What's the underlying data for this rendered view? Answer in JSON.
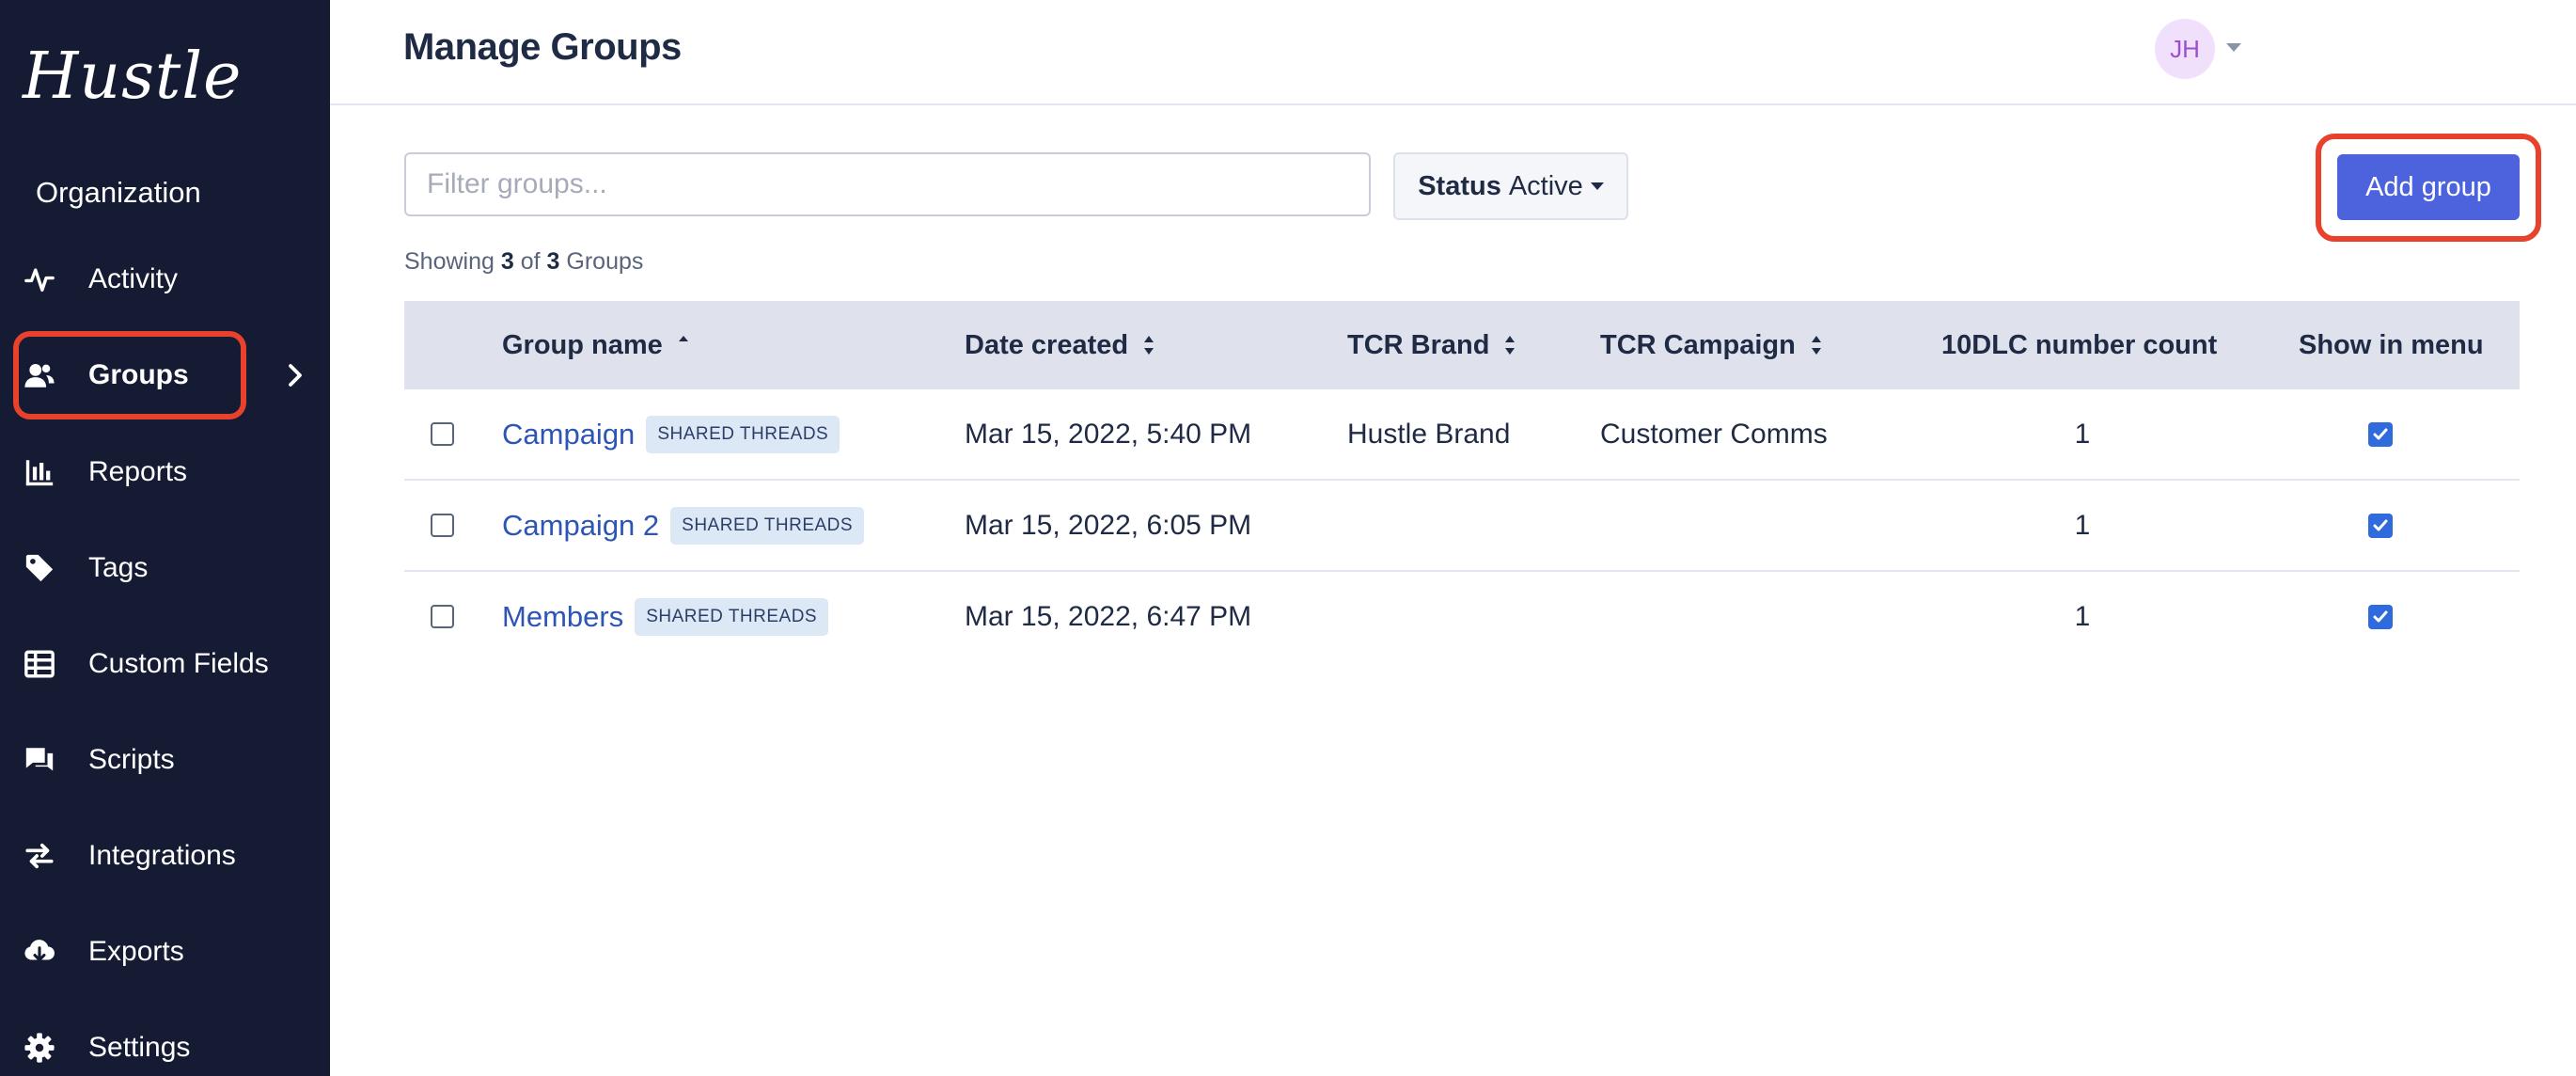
{
  "app": {
    "logo": "Hustle"
  },
  "sidebar": {
    "section_title": "Organization",
    "items": [
      {
        "label": "Activity",
        "icon": "activity-icon"
      },
      {
        "label": "Groups",
        "icon": "users-icon",
        "active": true
      },
      {
        "label": "Reports",
        "icon": "bar-chart-icon"
      },
      {
        "label": "Tags",
        "icon": "tag-icon"
      },
      {
        "label": "Custom Fields",
        "icon": "table-icon"
      },
      {
        "label": "Scripts",
        "icon": "chat-icon"
      },
      {
        "label": "Integrations",
        "icon": "swap-icon"
      },
      {
        "label": "Exports",
        "icon": "cloud-download-icon"
      },
      {
        "label": "Settings",
        "icon": "gear-icon"
      }
    ]
  },
  "header": {
    "title": "Manage Groups",
    "avatar_initials": "JH"
  },
  "toolbar": {
    "filter_placeholder": "Filter groups...",
    "status_key": "Status",
    "status_value": "Active",
    "add_label": "Add group"
  },
  "summary": {
    "prefix": "Showing",
    "shown": "3",
    "of": "of",
    "total": "3",
    "noun": "Groups"
  },
  "table": {
    "columns": [
      "Group name",
      "Date created",
      "TCR Brand",
      "TCR Campaign",
      "10DLC number count",
      "Show in menu"
    ],
    "rows": [
      {
        "name": "Campaign",
        "badge": "SHARED THREADS",
        "date": "Mar 15, 2022, 5:40 PM",
        "brand": "Hustle Brand",
        "campaign": "Customer Comms",
        "count": "1",
        "show": true
      },
      {
        "name": "Campaign 2",
        "badge": "SHARED THREADS",
        "date": "Mar 15, 2022, 6:05 PM",
        "brand": "",
        "campaign": "",
        "count": "1",
        "show": true
      },
      {
        "name": "Members",
        "badge": "SHARED THREADS",
        "date": "Mar 15, 2022, 6:47 PM",
        "brand": "",
        "campaign": "",
        "count": "1",
        "show": true
      }
    ]
  },
  "colors": {
    "sidebar_bg": "#141b33",
    "accent": "#4d63de",
    "highlight": "#e8412c",
    "link": "#2c55b5"
  }
}
